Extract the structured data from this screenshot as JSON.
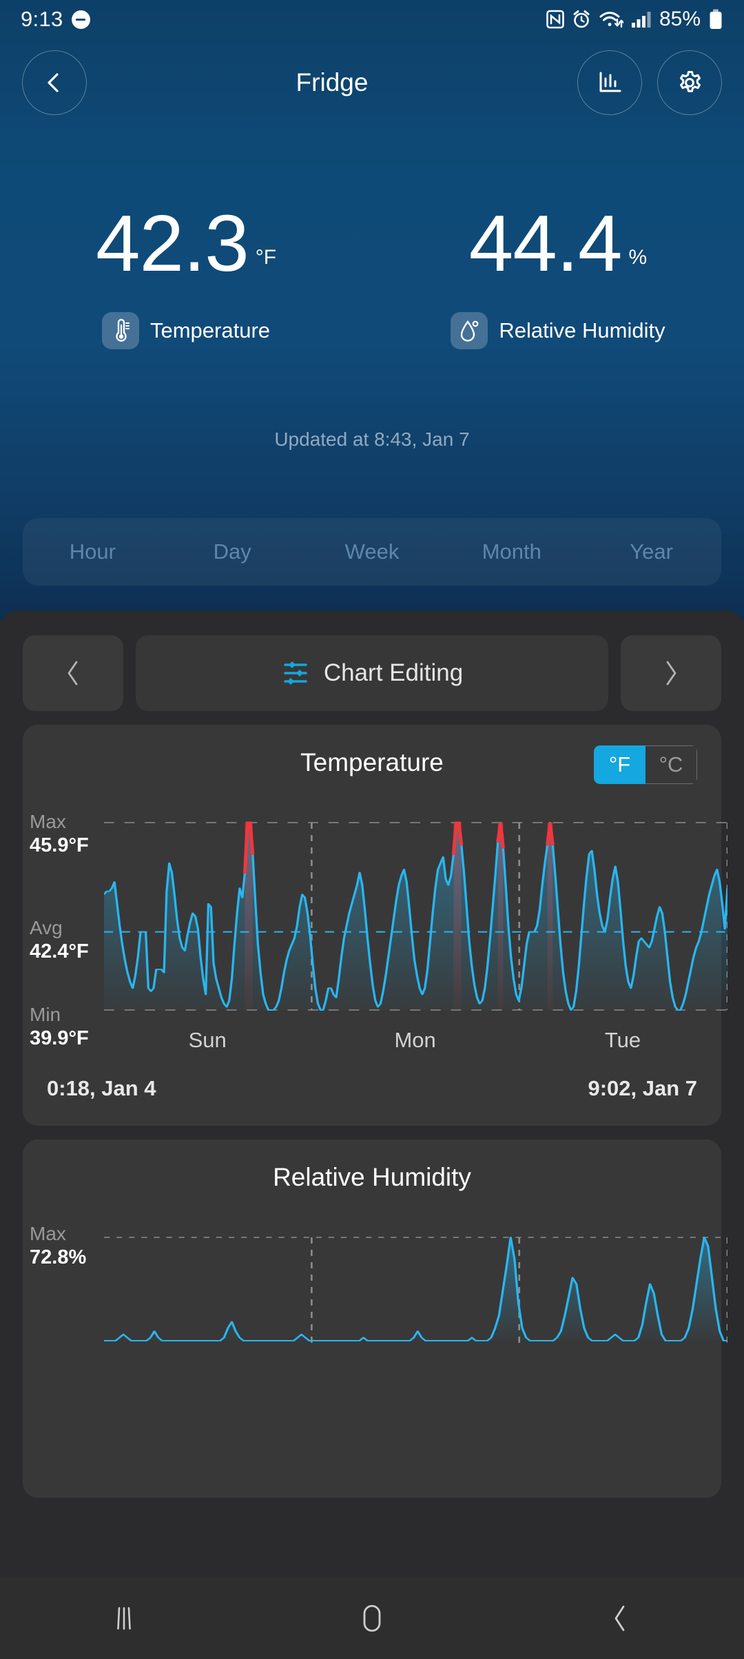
{
  "status_bar": {
    "time": "9:13",
    "battery": "85%",
    "icons": [
      "do-not-disturb-icon",
      "nfc-icon",
      "alarm-icon",
      "wifi-icon",
      "cellular-signal-icon",
      "battery-icon"
    ]
  },
  "app_bar": {
    "title": "Fridge",
    "back_icon": "chevron-left-icon",
    "chart_icon": "bar-chart-icon",
    "settings_icon": "gear-icon"
  },
  "readings": [
    {
      "value": "42.3",
      "unit": "°F",
      "label": "Temperature",
      "icon": "thermometer-icon"
    },
    {
      "value": "44.4",
      "unit": "%",
      "label": "Relative Humidity",
      "icon": "humidity-drop-icon"
    }
  ],
  "updated_text": "Updated at 8:43, Jan 7",
  "range_tabs": [
    {
      "label": "Hour",
      "active": false
    },
    {
      "label": "Day",
      "active": false
    },
    {
      "label": "Week",
      "active": false
    },
    {
      "label": "Month",
      "active": false
    },
    {
      "label": "Year",
      "active": false
    }
  ],
  "chart_editing": {
    "label": "Chart Editing",
    "icon": "sliders-icon",
    "prev_icon": "chevron-left-icon",
    "next_icon": "chevron-right-icon"
  },
  "colors": {
    "accent_cyan": "#29b6f0",
    "alert_red": "#f2363c",
    "header_blue": "#0e4a77",
    "sheet_dark": "#2b2b2d",
    "card_dark": "#383838",
    "toggle_on": "#14a7e0"
  },
  "temperature_card": {
    "title": "Temperature",
    "unit_toggle": {
      "options": [
        "°F",
        "°C"
      ],
      "selected": "°F"
    },
    "stats": [
      {
        "name": "Max",
        "value": "45.9°F"
      },
      {
        "name": "Avg",
        "value": "42.4°F"
      },
      {
        "name": "Min",
        "value": "39.9°F"
      }
    ],
    "day_labels": [
      "Sun",
      "Mon",
      "Tue"
    ],
    "range_start": "0:18, Jan 4",
    "range_end": "9:02, Jan 7"
  },
  "humidity_card": {
    "title": "Relative Humidity",
    "stats": [
      {
        "name": "Max",
        "value": "72.8%"
      }
    ]
  },
  "nav_bar": {
    "recents_icon": "recents-icon",
    "home_icon": "home-icon",
    "back_icon": "back-icon"
  },
  "chart_data": [
    {
      "type": "line",
      "title": "Temperature",
      "ylabel": "°F",
      "xlabel": "",
      "ylim": [
        39.9,
        45.9
      ],
      "max": 45.9,
      "avg": 42.4,
      "min": 39.9,
      "grid": true,
      "legend": "none",
      "x_tick_labels": [
        "Sun",
        "Mon",
        "Tue"
      ],
      "range_start": "0:18, Jan 4",
      "range_end": "9:02, Jan 7",
      "alert_threshold": 45.9,
      "values": [
        43.6,
        43.7,
        43.7,
        43.8,
        44.0,
        43.3,
        42.6,
        42.0,
        41.5,
        41.1,
        40.8,
        40.6,
        41.0,
        41.6,
        42.4,
        42.4,
        42.4,
        40.6,
        40.5,
        40.6,
        41.2,
        41.2,
        41.2,
        41.1,
        43.7,
        44.6,
        44.3,
        43.6,
        42.8,
        42.2,
        41.9,
        41.8,
        42.3,
        42.7,
        43.0,
        42.9,
        42.5,
        41.6,
        40.9,
        40.4,
        43.3,
        43.2,
        41.4,
        40.9,
        40.6,
        40.3,
        40.1,
        40.0,
        40.2,
        40.9,
        42.0,
        43.0,
        43.8,
        43.5,
        44.3,
        45.9,
        45.9,
        44.9,
        43.4,
        42.0,
        41.1,
        40.4,
        40.1,
        39.9,
        39.9,
        39.9,
        40.0,
        40.2,
        40.6,
        41.1,
        41.5,
        41.8,
        42.0,
        42.2,
        42.6,
        43.2,
        43.6,
        43.5,
        43.0,
        42.3,
        41.4,
        40.6,
        40.1,
        39.9,
        39.9,
        40.2,
        40.6,
        40.6,
        40.4,
        40.3,
        40.9,
        41.6,
        42.2,
        42.6,
        43.0,
        43.3,
        43.6,
        43.9,
        44.3,
        43.9,
        43.1,
        42.2,
        41.4,
        40.7,
        40.2,
        40.0,
        40.1,
        40.5,
        41.0,
        41.6,
        42.2,
        42.8,
        43.4,
        43.9,
        44.2,
        44.4,
        44.0,
        43.2,
        42.3,
        41.5,
        41.0,
        40.6,
        40.4,
        40.6,
        41.2,
        42.1,
        43.0,
        43.8,
        44.4,
        44.6,
        44.8,
        44.1,
        43.9,
        44.2,
        44.9,
        45.9,
        45.9,
        45.2,
        44.3,
        43.2,
        42.1,
        41.3,
        40.7,
        40.3,
        40.1,
        40.2,
        40.6,
        41.3,
        42.2,
        43.2,
        44.2,
        45.3,
        45.9,
        45.1,
        43.9,
        42.6,
        41.6,
        40.9,
        40.4,
        40.2,
        40.6,
        41.3,
        42.0,
        42.4,
        42.4,
        42.4,
        42.6,
        43.1,
        43.9,
        44.6,
        45.2,
        45.9,
        45.2,
        44.2,
        43.1,
        42.0,
        41.1,
        40.5,
        40.1,
        39.9,
        40.0,
        40.5,
        41.3,
        42.3,
        43.3,
        44.2,
        44.9,
        45.0,
        44.4,
        43.6,
        43.0,
        42.6,
        42.4,
        42.8,
        43.5,
        44.1,
        44.5,
        44.0,
        43.1,
        42.1,
        41.3,
        40.8,
        40.6,
        41.0,
        41.6,
        42.1,
        42.2,
        42.1,
        42.0,
        41.9,
        42.1,
        42.5,
        42.9,
        43.2,
        43.0,
        42.4,
        41.6,
        40.8,
        40.3,
        40.0,
        39.9,
        39.9,
        40.1,
        40.4,
        40.8,
        41.2,
        41.6,
        41.9,
        42.1,
        42.4,
        42.8,
        43.2,
        43.6,
        43.9,
        44.2,
        44.4,
        44.0,
        43.3,
        42.5,
        43.8
      ]
    },
    {
      "type": "line",
      "title": "Relative Humidity",
      "ylabel": "%",
      "max": 72.8,
      "grid": true,
      "legend": "none",
      "note": "chart clipped by navigation bar at bottom of screen",
      "values": [
        40,
        40,
        40,
        40,
        41,
        42,
        41,
        40,
        40,
        40,
        40,
        40,
        41,
        43,
        41,
        40,
        40,
        40,
        40,
        40,
        40,
        40,
        40,
        40,
        40,
        40,
        40,
        40,
        40,
        40,
        40,
        41,
        44,
        46,
        43,
        41,
        40,
        40,
        40,
        40,
        40,
        40,
        40,
        40,
        40,
        40,
        40,
        40,
        40,
        40,
        41,
        42,
        41,
        40,
        40,
        40,
        40,
        40,
        40,
        40,
        40,
        40,
        40,
        40,
        40,
        40,
        40,
        41,
        40,
        40,
        40,
        40,
        40,
        40,
        40,
        40,
        40,
        40,
        40,
        40,
        41,
        43,
        41,
        40,
        40,
        40,
        40,
        40,
        40,
        40,
        40,
        40,
        40,
        40,
        40,
        41,
        40,
        40,
        40,
        40,
        41,
        44,
        48,
        56,
        64,
        72.8,
        66,
        52,
        44,
        41,
        40,
        40,
        40,
        40,
        40,
        40,
        40,
        41,
        43,
        48,
        54,
        60,
        58,
        50,
        44,
        41,
        40,
        40,
        40,
        40,
        40,
        41,
        42,
        41,
        40,
        40,
        40,
        40,
        41,
        45,
        52,
        58,
        55,
        48,
        42,
        40,
        40,
        40,
        40,
        40,
        41,
        44,
        50,
        58,
        66,
        72.8,
        70,
        60,
        50,
        43,
        40,
        40
      ]
    }
  ]
}
